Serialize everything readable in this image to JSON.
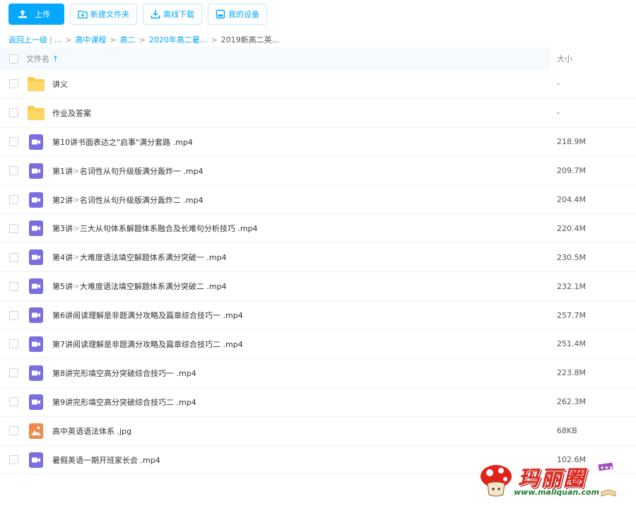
{
  "toolbar": {
    "upload": "上传",
    "new_folder": "新建文件夹",
    "offline_download": "离线下载",
    "my_devices": "我的设备"
  },
  "breadcrumb": {
    "back": "返回上一级",
    "ellipsis": "...",
    "items": [
      "高中课程",
      "高二",
      "2020年高二暑...",
      "2019新高二英..."
    ]
  },
  "table": {
    "col_name": "文件名",
    "col_size": "大小",
    "sort_arrow": "↑"
  },
  "files": [
    {
      "name": "讲义",
      "size": "-",
      "type": "folder"
    },
    {
      "name": "作业及答案",
      "size": "-",
      "type": "folder"
    },
    {
      "name": "第10讲书面表达之\"启事\"满分套路 .mp4",
      "size": "218.9M",
      "type": "video"
    },
    {
      "name": "第1讲☞名词性从句升级版满分轰炸一 .mp4",
      "size": "209.7M",
      "type": "video"
    },
    {
      "name": "第2讲☞名词性从句升级版满分轰炸二 .mp4",
      "size": "204.4M",
      "type": "video"
    },
    {
      "name": "第3讲☞三大从句体系解题体系融合及长难句分析技巧 .mp4",
      "size": "220.4M",
      "type": "video"
    },
    {
      "name": "第4讲☞大难度语法填空解题体系满分突破一 .mp4",
      "size": "230.5M",
      "type": "video"
    },
    {
      "name": "第5讲☞大难度语法填空解题体系满分突破二 .mp4",
      "size": "232.1M",
      "type": "video"
    },
    {
      "name": "第6讲阅读理解是非题满分攻略及篇章综合技巧一 .mp4",
      "size": "257.7M",
      "type": "video"
    },
    {
      "name": "第7讲阅读理解是非题满分攻略及篇章综合技巧二 .mp4",
      "size": "251.4M",
      "type": "video"
    },
    {
      "name": "第8讲完形填空高分突破综合技巧一 .mp4",
      "size": "223.8M",
      "type": "video"
    },
    {
      "name": "第9讲完形填空高分突破综合技巧二 .mp4",
      "size": "262.3M",
      "type": "video"
    },
    {
      "name": "高中英语语法体系 .jpg",
      "size": "68KB",
      "type": "image"
    },
    {
      "name": "暑假英语一期开班家长会 .mp4",
      "size": "102.6M",
      "type": "video"
    }
  ],
  "watermark": {
    "logo_text": "玛丽圈",
    "url": "www.maliquan.com"
  },
  "colors": {
    "accent": "#06a7ff",
    "folder": "#ffc94d",
    "video": "#7b6fe0",
    "image": "#f08a4b",
    "header_bg": "#f5faff"
  }
}
